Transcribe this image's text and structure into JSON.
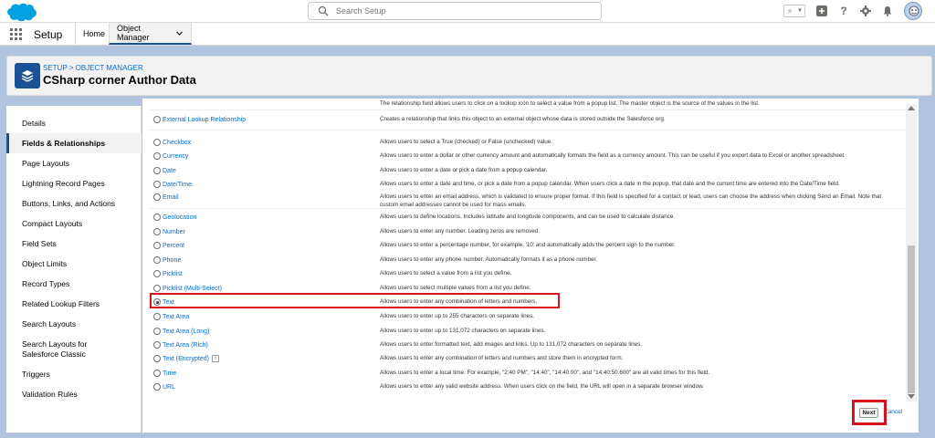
{
  "header": {
    "search_placeholder": "Search Setup",
    "icons": [
      "favorites-star-icon",
      "add-icon",
      "help-icon",
      "gear-icon",
      "bell-icon",
      "avatar"
    ]
  },
  "nav": {
    "app_name": "Setup",
    "tabs": [
      {
        "label": "Home"
      },
      {
        "label": "Object Manager"
      }
    ]
  },
  "page_header": {
    "breadcrumb_setup": "SETUP",
    "breadcrumb_sep": " > ",
    "breadcrumb_om": "OBJECT MANAGER",
    "title": "CSharp corner Author Data"
  },
  "sidebar": {
    "items": [
      {
        "label": "Details"
      },
      {
        "label": "Fields & Relationships"
      },
      {
        "label": "Page Layouts"
      },
      {
        "label": "Lightning Record Pages"
      },
      {
        "label": "Buttons, Links, and Actions"
      },
      {
        "label": "Compact Layouts"
      },
      {
        "label": "Field Sets"
      },
      {
        "label": "Object Limits"
      },
      {
        "label": "Record Types"
      },
      {
        "label": "Related Lookup Filters"
      },
      {
        "label": "Search Layouts"
      },
      {
        "label": "Search Layouts for Salesforce Classic"
      },
      {
        "label": "Triggers"
      },
      {
        "label": "Validation Rules"
      }
    ],
    "active_index": 1
  },
  "field_types": {
    "partial_top_text": "The relationship field allows users to click on a lookup icon to select a value from a popup list. The master object is the source of the values in the list.",
    "rows": [
      {
        "label": "External Lookup Relationship",
        "desc": "Creates a relationship that links this object to an external object whose data is stored outside the Salesforce org."
      },
      {
        "label": "Checkbox",
        "desc": "Allows users to select a True (checked) or False (unchecked) value."
      },
      {
        "label": "Currency",
        "desc": "Allows users to enter a dollar or other currency amount and automatically formats the field as a currency amount. This can be useful if you export data to Excel or another spreadsheet."
      },
      {
        "label": "Date",
        "desc": "Allows users to enter a date or pick a date from a popup calendar."
      },
      {
        "label": "Date/Time",
        "desc": "Allows users to enter a date and time, or pick a date from a popup calendar. When users click a date in the popup, that date and the current time are entered into the Date/Time field."
      },
      {
        "label": "Email",
        "desc": "Allows users to enter an email address, which is validated to ensure proper format. If this field is specified for a contact or lead, users can choose the address when clicking Send an Email. Note that custom email addresses cannot be used for mass emails."
      },
      {
        "label": "Geolocation",
        "desc": "Allows users to define locations. Includes latitude and longitude components, and can be used to calculate distance."
      },
      {
        "label": "Number",
        "desc": "Allows users to enter any number. Leading zeros are removed."
      },
      {
        "label": "Percent",
        "desc": "Allows users to enter a percentage number, for example, '10' and automatically adds the percent sign to the number."
      },
      {
        "label": "Phone",
        "desc": "Allows users to enter any phone number. Automatically formats it as a phone number."
      },
      {
        "label": "Picklist",
        "desc": "Allows users to select a value from a list you define."
      },
      {
        "label": "Picklist (Multi-Select)",
        "desc": "Allows users to select multiple values from a list you define."
      },
      {
        "label": "Text",
        "desc": "Allows users to enter any combination of letters and numbers.",
        "selected": true
      },
      {
        "label": "Text Area",
        "desc": "Allows users to enter up to 255 characters on separate lines."
      },
      {
        "label": "Text Area (Long)",
        "desc": "Allows users to enter up to 131,072 characters on separate lines."
      },
      {
        "label": "Text Area (Rich)",
        "desc": "Allows users to enter formatted text, add images and links. Up to 131,072 characters on separate lines."
      },
      {
        "label": "Text (Encrypted)",
        "desc": "Allows users to enter any combination of letters and numbers and store them in encrypted form.",
        "info": "i"
      },
      {
        "label": "Time",
        "desc": "Allows users to enter a local time. For example, \"2:40 PM\", \"14:40\", \"14:40:00\", and \"14:40:50.600\" are all valid times for this field."
      },
      {
        "label": "URL",
        "desc": "Allows users to enter any valid website address. When users click on the field, the URL will open in a separate browser window."
      }
    ]
  },
  "footer": {
    "next_label": "Next",
    "cancel_label": "Cancel"
  },
  "colors": {
    "brand": "#1b5297",
    "link": "#006dcc",
    "highlight": "#d9141f",
    "background": "#b0c4df"
  }
}
